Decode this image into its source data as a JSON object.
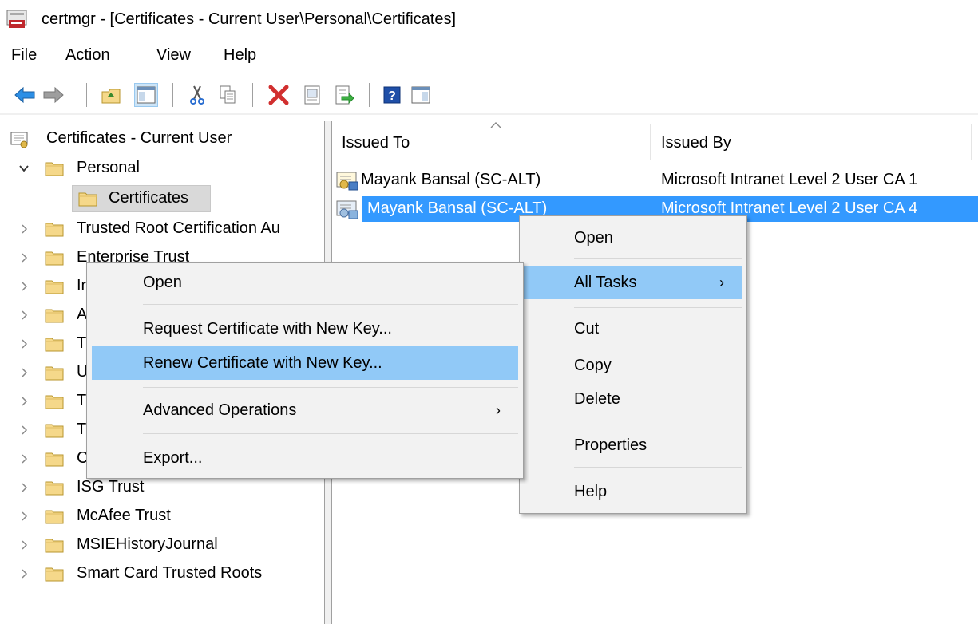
{
  "window": {
    "title": "certmgr - [Certificates - Current User\\Personal\\Certificates]"
  },
  "menubar": {
    "items": [
      "File",
      "Action",
      "View",
      "Help"
    ]
  },
  "toolbar": {
    "buttons": [
      "back-arrow-icon",
      "forward-arrow-icon",
      "up-folder-icon",
      "show-hide-tree-icon",
      "cut-icon",
      "copy-icon",
      "delete-icon",
      "properties-icon",
      "export-list-icon",
      "help-icon",
      "show-hide-action-pane-icon"
    ]
  },
  "tree": {
    "root": "Certificates - Current User",
    "items": [
      {
        "label": "Personal",
        "expanded": true
      },
      {
        "label": "Certificates",
        "selected": true
      },
      {
        "label": "Trusted Root Certification Au"
      },
      {
        "label": "Enterprise Trust"
      },
      {
        "label": "In"
      },
      {
        "label": "A"
      },
      {
        "label": "T"
      },
      {
        "label": "U"
      },
      {
        "label": "T"
      },
      {
        "label": "T"
      },
      {
        "label": "C"
      },
      {
        "label": "ISG Trust"
      },
      {
        "label": "McAfee Trust"
      },
      {
        "label": "MSIEHistoryJournal"
      },
      {
        "label": "Smart Card Trusted Roots"
      }
    ]
  },
  "list": {
    "columns": [
      "Issued To",
      "Issued By"
    ],
    "rows": [
      {
        "issued_to": "Mayank Bansal (SC-ALT)",
        "issued_by": "Microsoft Intranet Level 2 User CA 1",
        "selected": false
      },
      {
        "issued_to": "Mayank Bansal (SC-ALT)",
        "issued_by": "Microsoft Intranet Level 2 User CA 4",
        "selected": true
      }
    ]
  },
  "context_menu": {
    "items": [
      "Open",
      "All Tasks",
      "Cut",
      "Copy",
      "Delete",
      "Properties",
      "Help"
    ],
    "highlighted": "All Tasks"
  },
  "submenu": {
    "items": [
      "Open",
      "Request Certificate with New Key...",
      "Renew Certificate with New Key...",
      "Advanced Operations",
      "Export..."
    ],
    "highlighted": "Renew Certificate with New Key..."
  },
  "colors": {
    "selection": "#3399ff",
    "menu_highlight": "#91c9f7",
    "folder": "#f5d88a"
  }
}
